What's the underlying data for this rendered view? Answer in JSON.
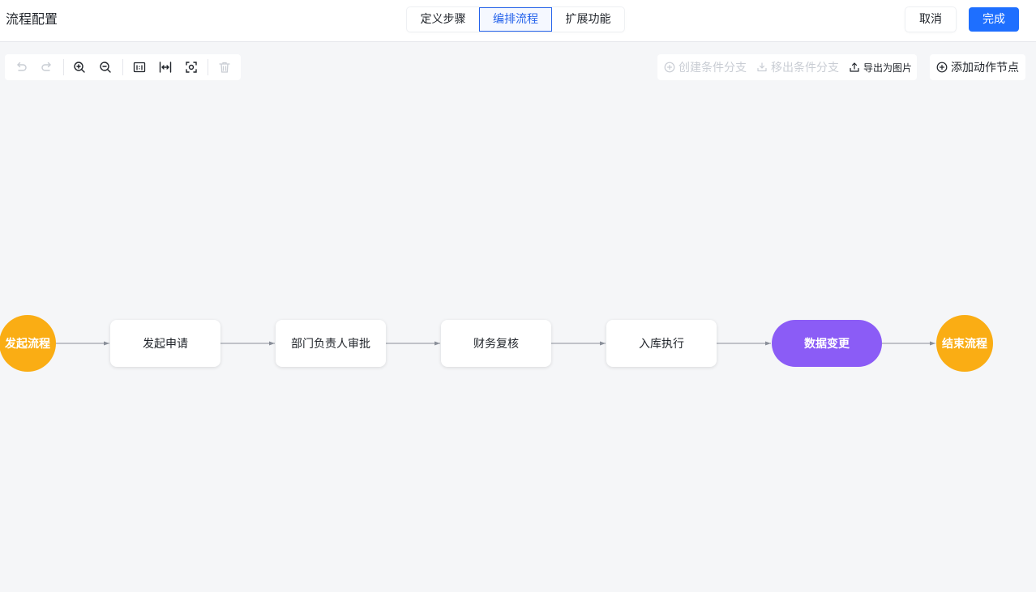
{
  "header": {
    "title": "流程配置",
    "tabs": [
      {
        "label": "定义步骤",
        "active": false
      },
      {
        "label": "编排流程",
        "active": true
      },
      {
        "label": "扩展功能",
        "active": false
      }
    ],
    "cancel_label": "取消",
    "done_label": "完成",
    "accent_color": "#1e6fff"
  },
  "toolbar": {
    "tools": [
      "undo-icon",
      "redo-icon",
      "zoom-in-icon",
      "zoom-out-icon",
      "actual-size-icon",
      "fit-width-icon",
      "fit-view-icon",
      "delete-icon"
    ]
  },
  "actions": {
    "create_branch": "创建条件分支",
    "remove_branch": "移出条件分支",
    "export_image": "导出为图片",
    "add_action_node": "添加动作节点"
  },
  "flow": {
    "nodes": [
      {
        "label": "发起流程",
        "kind": "start",
        "color": "#faad14"
      },
      {
        "label": "发起申请",
        "kind": "step"
      },
      {
        "label": "部门负责人审批",
        "kind": "step"
      },
      {
        "label": "财务复核",
        "kind": "step"
      },
      {
        "label": "入库执行",
        "kind": "step"
      },
      {
        "label": "数据变更",
        "kind": "action",
        "color": "#8b5cf6"
      },
      {
        "label": "结束流程",
        "kind": "end",
        "color": "#faad14"
      }
    ]
  }
}
